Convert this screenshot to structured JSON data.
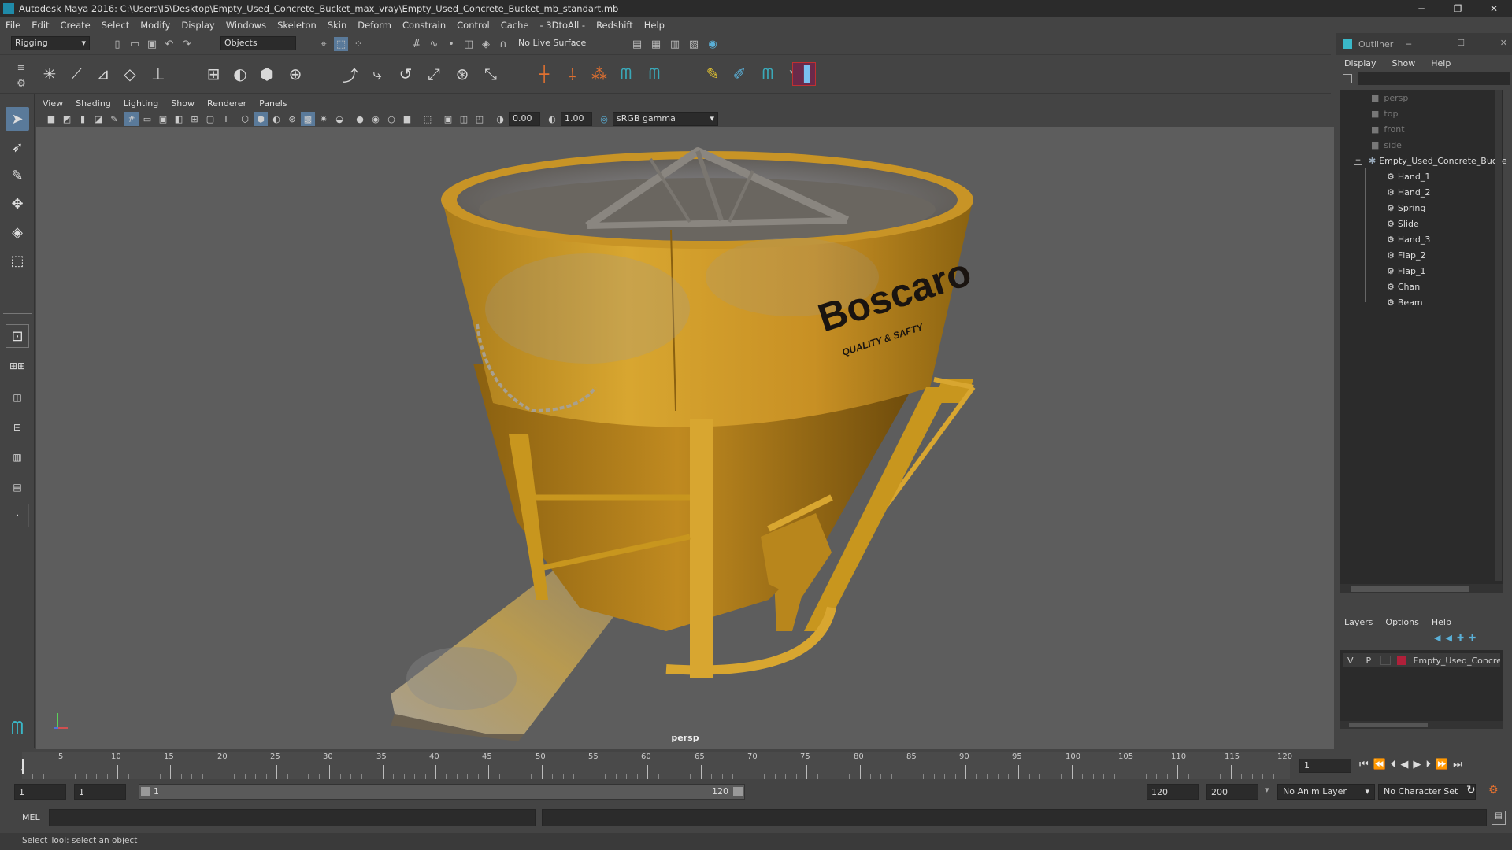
{
  "window": {
    "title": "Autodesk Maya 2016: C:\\Users\\I5\\Desktop\\Empty_Used_Concrete_Bucket_max_vray\\Empty_Used_Concrete_Bucket_mb_standart.mb"
  },
  "menu": [
    "File",
    "Edit",
    "Create",
    "Select",
    "Modify",
    "Display",
    "Windows",
    "Skeleton",
    "Skin",
    "Deform",
    "Constrain",
    "Control",
    "Cache",
    "- 3DtoAll -",
    "Redshift",
    "Help"
  ],
  "statusline": {
    "mode": "Rigging",
    "selection_mask": "Objects",
    "live_surface": "No Live Surface"
  },
  "panel_menu": [
    "View",
    "Shading",
    "Lighting",
    "Show",
    "Renderer",
    "Panels"
  ],
  "panel_tools": {
    "exposure": "0.00",
    "gamma": "1.00",
    "color_space": "sRGB gamma"
  },
  "viewport": {
    "camera_label": "persp",
    "brand_text": "Boscaro",
    "brand_sub": "QUALITY & SAFTY"
  },
  "outliner": {
    "title": "Outliner",
    "menu": [
      "Display",
      "Show",
      "Help"
    ],
    "cameras": [
      "persp",
      "top",
      "front",
      "side"
    ],
    "root": "Empty_Used_Concrete_Bucke",
    "children": [
      "Hand_1",
      "Hand_2",
      "Spring",
      "Slide",
      "Hand_3",
      "Flap_2",
      "Flap_1",
      "Chan",
      "Beam"
    ]
  },
  "layers": {
    "menu": [
      "Layers",
      "Options",
      "Help"
    ],
    "row": {
      "v": "V",
      "p": "P",
      "name": "Empty_Used_Concrete",
      "color": "#b0203a"
    }
  },
  "timeline": {
    "ticks": [
      "5",
      "10",
      "15",
      "20",
      "25",
      "30",
      "35",
      "40",
      "45",
      "50",
      "55",
      "60",
      "65",
      "70",
      "75",
      "80",
      "85",
      "90",
      "95",
      "100",
      "105",
      "110",
      "115",
      "120"
    ],
    "first_tick": "1",
    "current_frame": "1"
  },
  "range": {
    "start": "1",
    "start_inner": "1",
    "slider_start": "1",
    "slider_end": "120",
    "end_inner": "120",
    "end": "200",
    "anim_layer": "No Anim Layer",
    "char_set": "No Character Set"
  },
  "cmdline": {
    "label": "MEL"
  },
  "helpline": {
    "text": "Select Tool: select an object"
  },
  "colors": {
    "accent": "#5aa0d8",
    "bucket": "#d4a02a",
    "layer_swatch": "#b0203a"
  }
}
